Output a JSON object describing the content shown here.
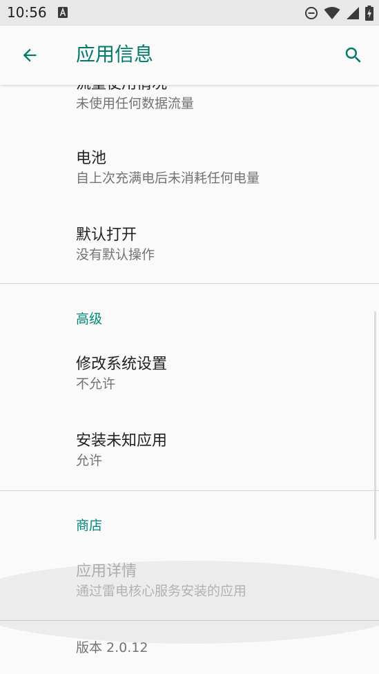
{
  "status_bar": {
    "time": "10:56",
    "left_icons": [
      "a-notification-icon"
    ],
    "right_icons": [
      "do-not-disturb-icon",
      "wifi-icon",
      "cell-signal-icon",
      "battery-charging-icon"
    ]
  },
  "app_bar": {
    "title": "应用信息",
    "back_icon": "arrow-back-icon",
    "search_icon": "search-icon",
    "accent_color": "#00796b"
  },
  "items": [
    {
      "title": "流量使用情况",
      "summary": "未使用任何数据流量"
    },
    {
      "title": "电池",
      "summary": "自上次充满电后未消耗任何电量"
    },
    {
      "title": "默认打开",
      "summary": "没有默认操作"
    }
  ],
  "advanced": {
    "header": "高级",
    "items": [
      {
        "title": "修改系统设置",
        "summary": "不允许"
      },
      {
        "title": "安装未知应用",
        "summary": "允许"
      }
    ]
  },
  "store": {
    "header": "商店",
    "items": [
      {
        "title": "应用详情",
        "summary": "通过雷电核心服务安装的应用",
        "enabled": false
      }
    ]
  },
  "footer": {
    "version": "版本 2.0.12"
  }
}
